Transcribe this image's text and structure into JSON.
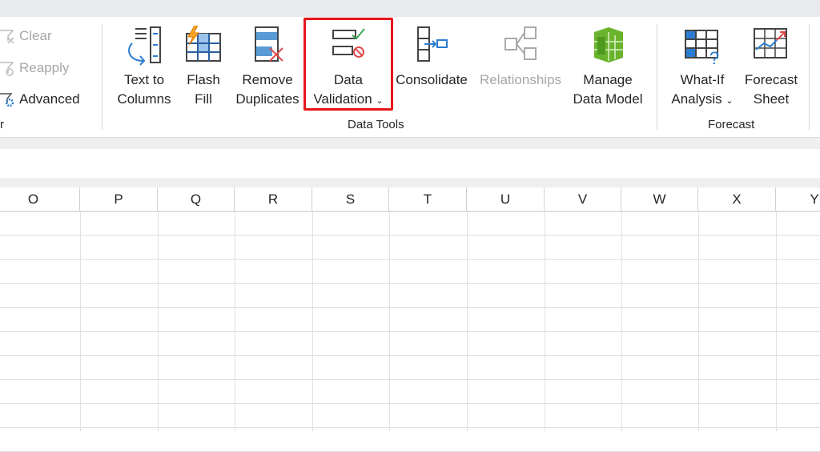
{
  "sort_filter": {
    "items": [
      {
        "label": "Clear",
        "enabled": false
      },
      {
        "label": "Reapply",
        "enabled": false
      },
      {
        "label": "Advanced",
        "enabled": true
      }
    ],
    "group_label_fragment": "r"
  },
  "data_tools": {
    "group_label": "Data Tools",
    "buttons": [
      {
        "line1": "Text to",
        "line2": "Columns"
      },
      {
        "line1": "Flash",
        "line2": "Fill"
      },
      {
        "line1": "Remove",
        "line2": "Duplicates"
      },
      {
        "line1": "Data",
        "line2": "Validation",
        "dropdown": true,
        "highlighted": true
      },
      {
        "line1": "Consolidate",
        "line2": ""
      },
      {
        "line1": "Relationships",
        "line2": "",
        "enabled": false
      },
      {
        "line1": "Manage",
        "line2": "Data Model"
      }
    ]
  },
  "forecast": {
    "group_label": "Forecast",
    "buttons": [
      {
        "line1": "What-If",
        "line2": "Analysis",
        "dropdown": true
      },
      {
        "line1": "Forecast",
        "line2": "Sheet"
      }
    ]
  },
  "columns": [
    "O",
    "P",
    "Q",
    "R",
    "S",
    "T",
    "U",
    "V",
    "W",
    "X",
    "Y"
  ],
  "colors": {
    "highlight": "#e8141a",
    "accent_blue": "#2b7cd3",
    "green": "#6ab42d"
  }
}
